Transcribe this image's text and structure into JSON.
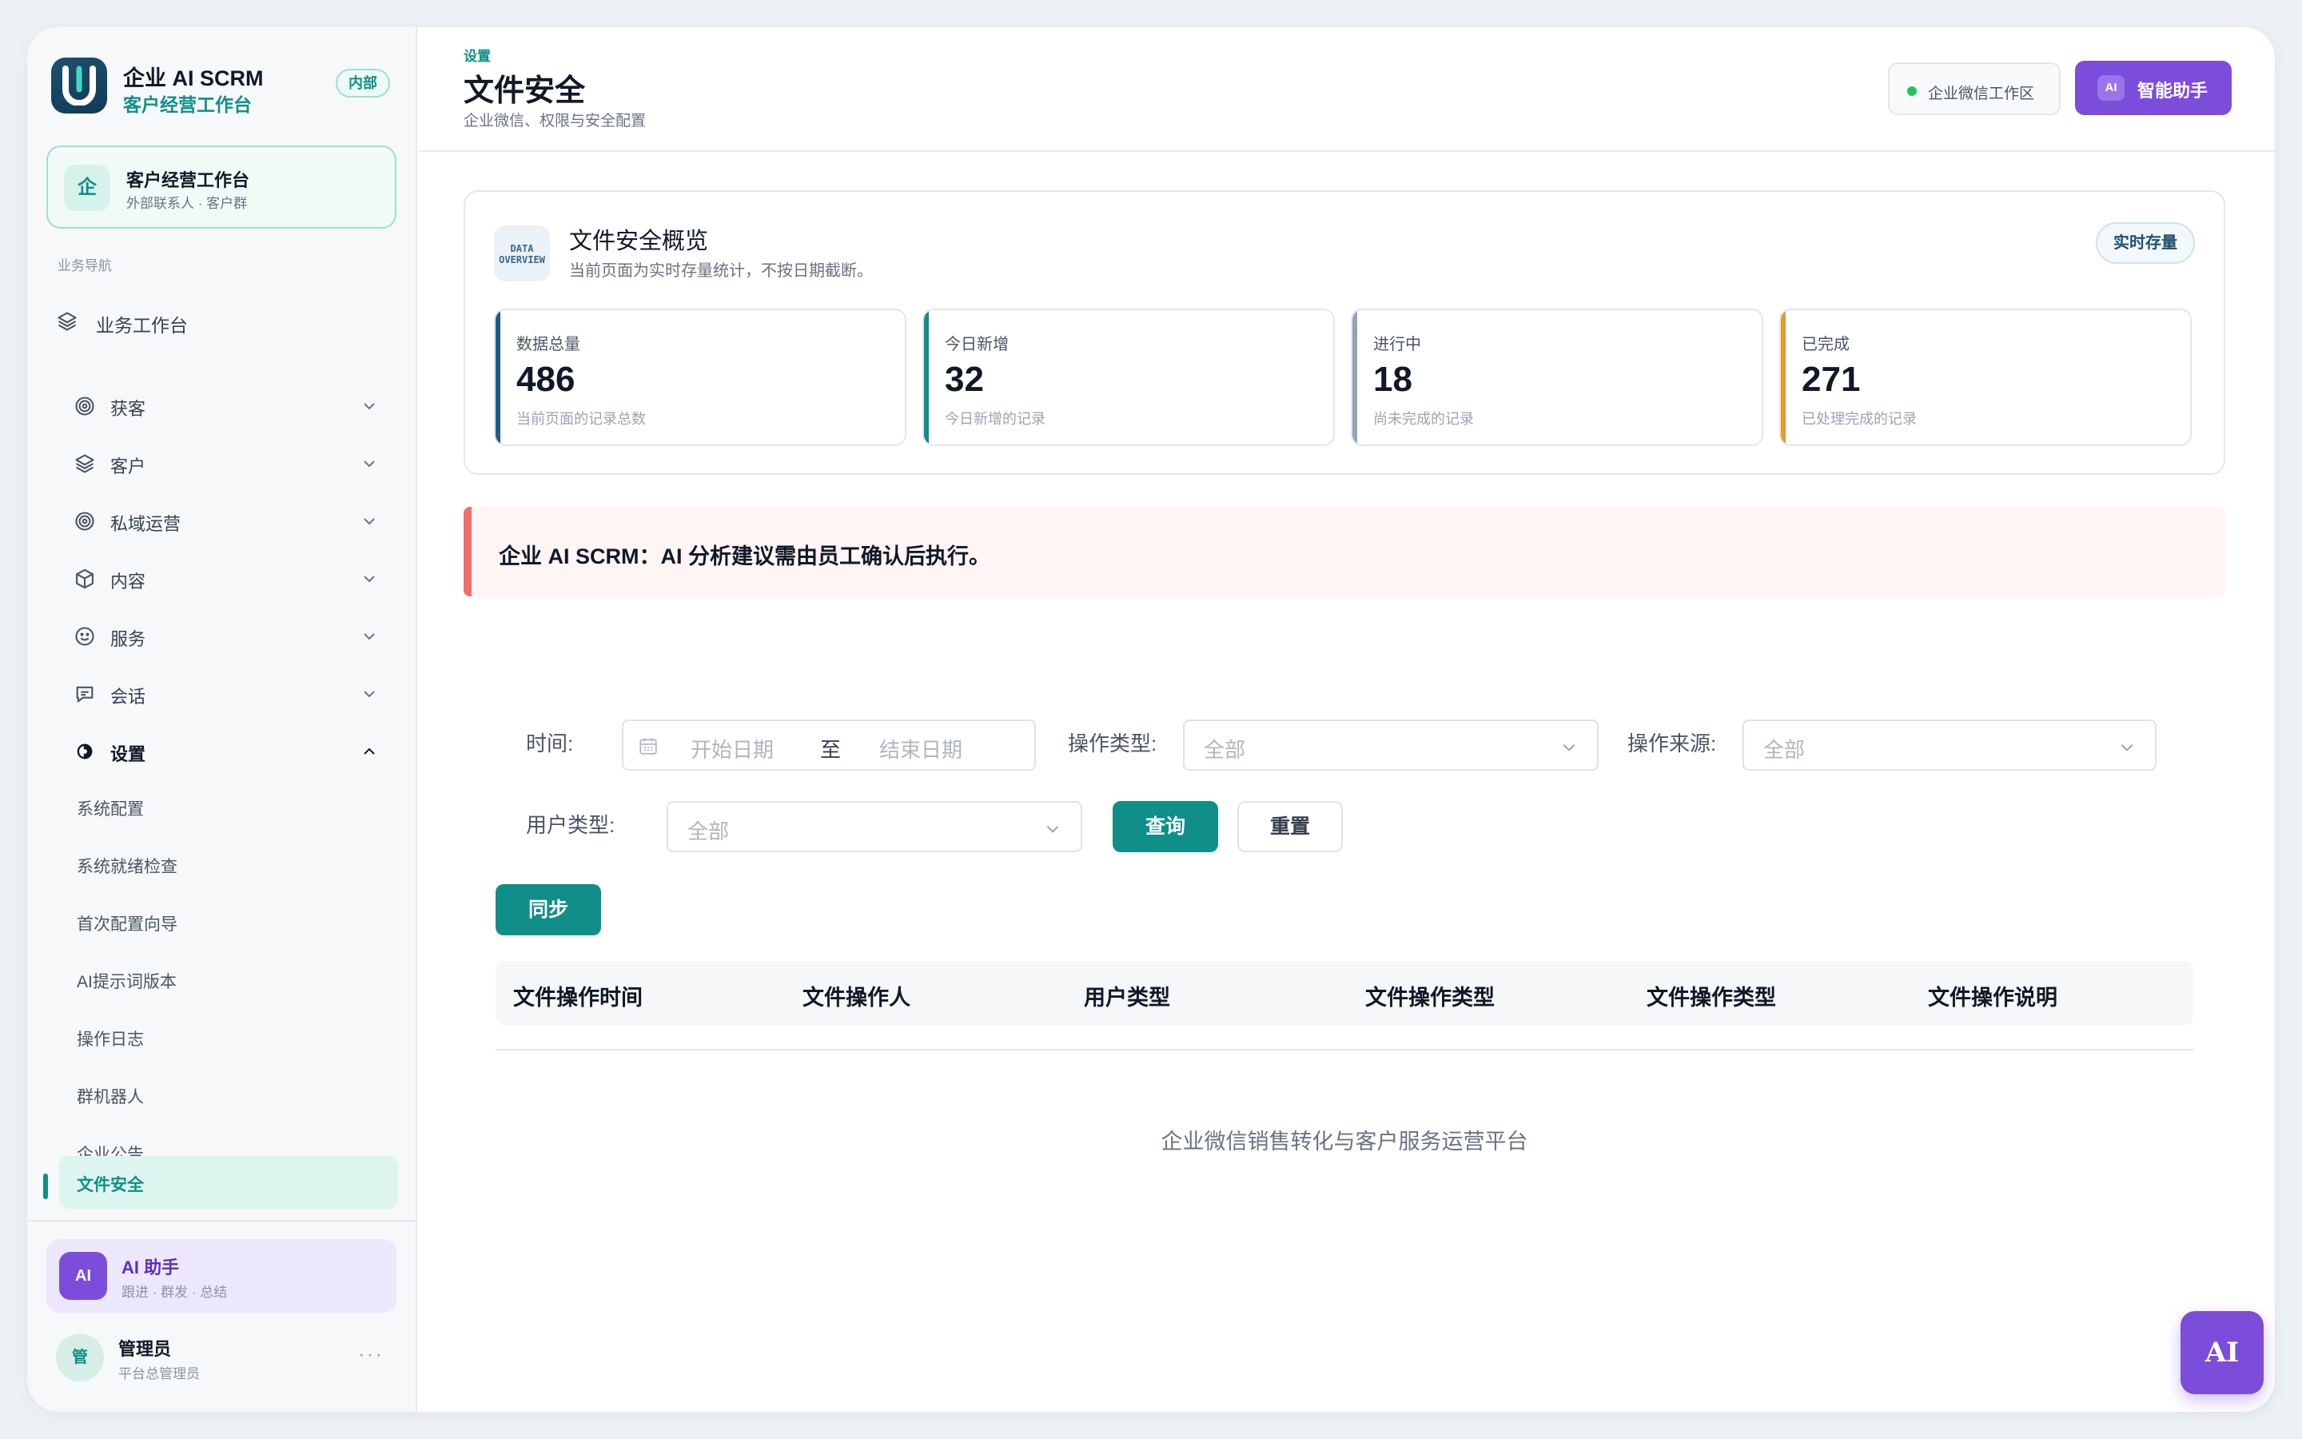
{
  "brand": {
    "name": "企业 AI SCRM",
    "subtitle": "客户经营工作台",
    "tag": "内部"
  },
  "workspace_card": {
    "icon": "企",
    "title": "客户经营工作台",
    "subtitle": "外部联系人 · 客户群"
  },
  "sidebar": {
    "section_label": "业务导航",
    "top_item": {
      "label": "业务工作台",
      "icon": "layers-icon"
    },
    "items": [
      {
        "label": "获客",
        "icon": "target-icon"
      },
      {
        "label": "客户",
        "icon": "layers-icon"
      },
      {
        "label": "私域运营",
        "icon": "target-icon"
      },
      {
        "label": "内容",
        "icon": "box-icon"
      },
      {
        "label": "服务",
        "icon": "smile-icon"
      },
      {
        "label": "会话",
        "icon": "chat-icon"
      },
      {
        "label": "设置",
        "icon": "settings-icon"
      }
    ],
    "sub_items": [
      {
        "label": "系统配置"
      },
      {
        "label": "系统就绪检查"
      },
      {
        "label": "首次配置向导"
      },
      {
        "label": "AI提示词版本"
      },
      {
        "label": "操作日志"
      },
      {
        "label": "群机器人"
      },
      {
        "label": "企业公告"
      },
      {
        "label": "文件安全"
      }
    ],
    "active_sub_item": "文件安全"
  },
  "ai_card": {
    "badge": "AI",
    "title": "AI 助手",
    "subtitle": "跟进 · 群发 · 总结"
  },
  "user": {
    "avatar": "管",
    "name": "管理员",
    "role": "平台总管理员",
    "more": "···"
  },
  "header": {
    "breadcrumb": "设置",
    "title": "文件安全",
    "subtitle": "企业微信、权限与安全配置",
    "workspace_chip": "企业微信工作区",
    "ai_button_badge": "AI",
    "ai_button_label": "智能助手"
  },
  "overview": {
    "icon_text_1": "DATA",
    "icon_text_2": "OVERVIEW",
    "title": "文件安全概览",
    "subtitle": "当前页面为实时存量统计，不按日期截断。",
    "tag": "实时存量",
    "stats": [
      {
        "label": "数据总量",
        "value": "486",
        "desc": "当前页面的记录总数",
        "color": "#1f5d86"
      },
      {
        "label": "今日新增",
        "value": "32",
        "desc": "今日新增的记录",
        "color": "#0f8f87"
      },
      {
        "label": "进行中",
        "value": "18",
        "desc": "尚未完成的记录",
        "color": "#94a3b8"
      },
      {
        "label": "已完成",
        "value": "271",
        "desc": "已处理完成的记录",
        "color": "#e59a2b"
      }
    ]
  },
  "notice": "企业 AI SCRM：AI 分析建议需由员工确认后执行。",
  "filters": {
    "time_label": "时间:",
    "start_placeholder": "开始日期",
    "range_sep": "至",
    "end_placeholder": "结束日期",
    "op_type_label": "操作类型:",
    "op_type_value": "全部",
    "op_source_label": "操作来源:",
    "op_source_value": "全部",
    "user_type_label": "用户类型:",
    "user_type_value": "全部",
    "query_button": "查询",
    "reset_button": "重置",
    "sync_button": "同步"
  },
  "table": {
    "columns": [
      "文件操作时间",
      "文件操作人",
      "用户类型",
      "文件操作类型",
      "文件操作类型",
      "文件操作说明"
    ],
    "empty_text": "企业微信销售转化与客户服务运营平台"
  },
  "fab": "AI"
}
